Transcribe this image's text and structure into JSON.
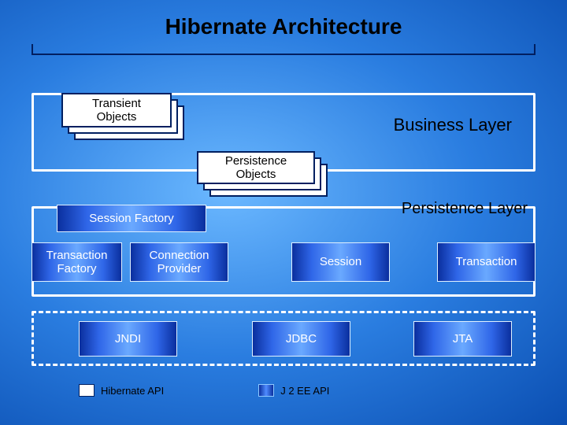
{
  "title": "Hibernate Architecture",
  "business_layer": {
    "label": "Business Layer"
  },
  "transient_objects": {
    "label": "Transient\nObjects"
  },
  "persistence_objects": {
    "label": "Persistence\nObjects"
  },
  "persistence_layer": {
    "label": "Persistence Layer"
  },
  "boxes": {
    "session_factory": "Session Factory",
    "transaction_factory": "Transaction\nFactory",
    "connection_provider": "Connection\nProvider",
    "session": "Session",
    "transaction": "Transaction",
    "jndi": "JNDI",
    "jdbc": "JDBC",
    "jta": "JTA"
  },
  "legend": {
    "hibernate_api": "Hibernate API",
    "j2ee_api": "J 2 EE API"
  }
}
